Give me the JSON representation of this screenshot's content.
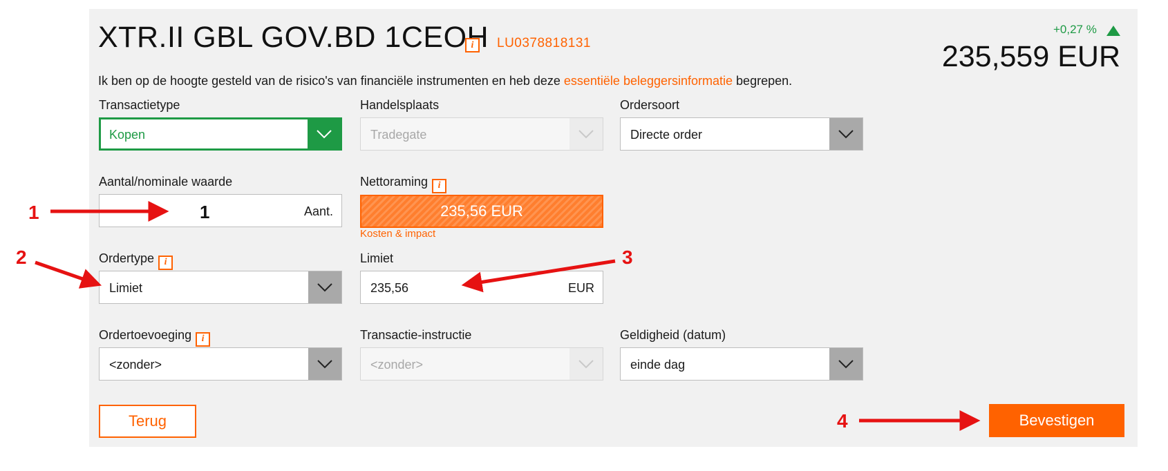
{
  "instrument": {
    "name": "XTR.II GBL GOV.BD 1CEOH",
    "isin": "LU0378818131",
    "change": "+0,27 %",
    "price": "235,559 EUR"
  },
  "disclaimer": {
    "before": "Ik ben op de hoogte gesteld van de risico's van financiële instrumenten en heb deze ",
    "link": "essentiële beleggersinformatie",
    "after": " begrepen."
  },
  "form": {
    "transactietype": {
      "label": "Transactietype",
      "value": "Kopen"
    },
    "handelsplaats": {
      "label": "Handelsplaats",
      "value": "Tradegate"
    },
    "ordersoort": {
      "label": "Ordersoort",
      "value": "Directe order"
    },
    "aantal": {
      "label": "Aantal/nominale waarde",
      "value": "1",
      "unit": "Aant."
    },
    "nettoraming": {
      "label": "Nettoraming",
      "value": "235,56 EUR",
      "link": "Kosten & impact"
    },
    "ordertype": {
      "label": "Ordertype",
      "value": "Limiet"
    },
    "limiet": {
      "label": "Limiet",
      "value": "235,56",
      "unit": "EUR"
    },
    "ordertoevoeging": {
      "label": "Ordertoevoeging",
      "value": "<zonder>"
    },
    "transactie_instructie": {
      "label": "Transactie-instructie",
      "value": "<zonder>"
    },
    "geldigheid": {
      "label": "Geldigheid (datum)",
      "value": "einde dag"
    }
  },
  "buttons": {
    "back": "Terug",
    "confirm": "Bevestigen"
  },
  "annotations": [
    "1",
    "2",
    "3",
    "4"
  ],
  "icons": {
    "info": "i"
  },
  "colors": {
    "accent": "#ff6200",
    "positive": "#1e9a45",
    "annotation": "#e61212"
  }
}
